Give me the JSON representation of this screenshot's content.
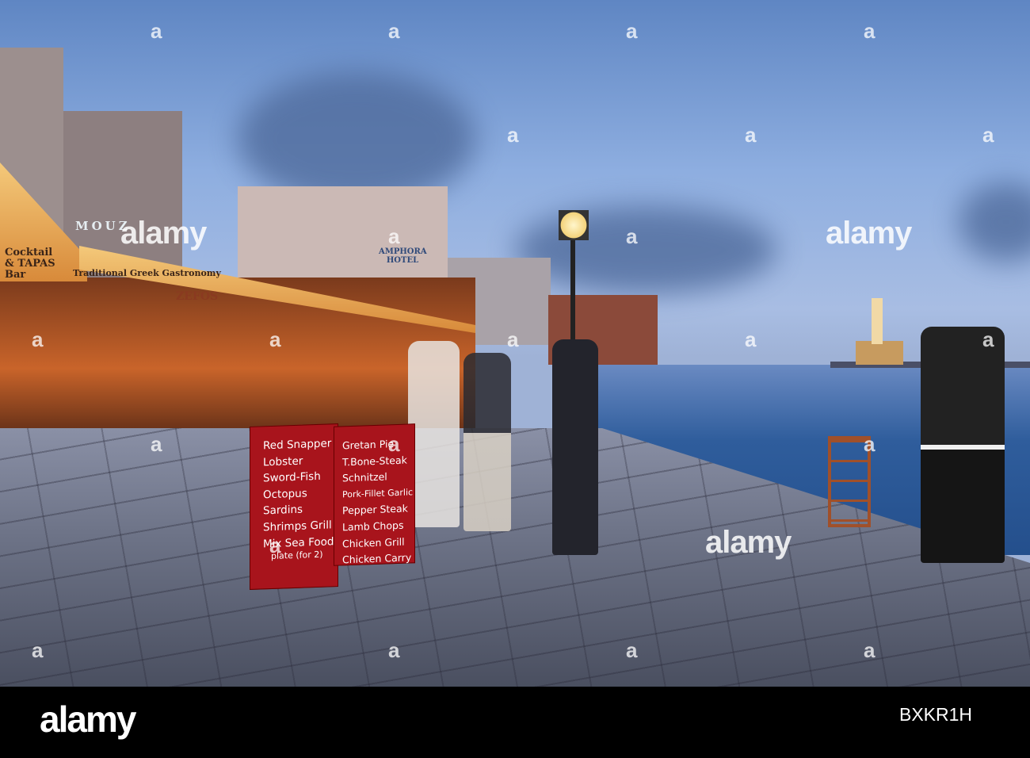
{
  "watermark": {
    "brand": "alamy",
    "letter": "a"
  },
  "footer": {
    "logo": "alamy",
    "image_id": "BXKR1H"
  },
  "building_signs": [
    "MOUZ",
    "Cocktail & TAPAS Bar",
    "Traditional Greek Gastronomy",
    "ZEFOS",
    "AMPHORA HOTEL"
  ],
  "menu_board_left": [
    "Red Snapper",
    "Lobster",
    "Sword-Fish",
    "Octopus",
    "Sardins",
    "Shrimps Grill",
    "Mix Sea Food",
    "plate (for 2)"
  ],
  "menu_board_right": [
    "Gretan Pie",
    "T.Bone-Steak",
    "Schnitzel",
    "Pork-Fillet Garlic",
    "Pepper Steak",
    "Lamb Chops",
    "Chicken Grill",
    "Chicken Carry"
  ]
}
